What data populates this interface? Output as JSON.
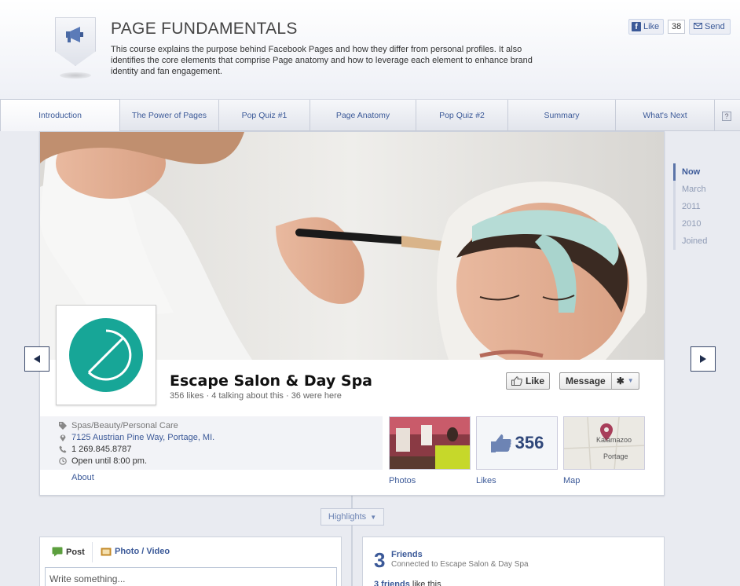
{
  "header": {
    "title": "PAGE FUNDAMENTALS",
    "description": "This course explains the purpose behind Facebook Pages and how they differ from personal profiles. It also identifies the core elements that comprise Page anatomy and how to leverage each element to enhance brand identity and fan engagement.",
    "like_label": "Like",
    "like_count": "38",
    "send_label": "Send",
    "help_label": "?"
  },
  "tabs": [
    {
      "label": "Introduction"
    },
    {
      "label": "The Power of Pages"
    },
    {
      "label": "Pop Quiz #1"
    },
    {
      "label": "Page Anatomy"
    },
    {
      "label": "Pop Quiz #2"
    },
    {
      "label": "Summary"
    },
    {
      "label": "What's Next"
    }
  ],
  "page": {
    "name": "Escape Salon & Day Spa",
    "stats": "356 likes · 4 talking about this · 36 were here",
    "like_button": "Like",
    "message_button": "Message",
    "info": {
      "category": "Spas/Beauty/Personal Care",
      "address": "7125 Austrian Pine Way, Portage, MI.",
      "phone": "1 269.845.8787",
      "hours": "Open until 8:00 pm."
    },
    "about_label": "About",
    "thumbs": {
      "photos_label": "Photos",
      "likes_label": "Likes",
      "likes_count": "356",
      "map_label": "Map",
      "map_city1": "Kalamazoo",
      "map_city2": "Portage"
    }
  },
  "timeline": [
    {
      "label": "Now"
    },
    {
      "label": "March"
    },
    {
      "label": "2011"
    },
    {
      "label": "2010"
    },
    {
      "label": "Joined"
    }
  ],
  "highlights_label": "Highlights",
  "composer": {
    "post_label": "Post",
    "photo_label": "Photo / Video",
    "placeholder": "Write something..."
  },
  "friends": {
    "count": "3",
    "title": "Friends",
    "subtitle_prefix": "Connected to",
    "subtitle_page": "Escape Salon & Day Spa",
    "like_line_link": "3 friends",
    "like_line_rest": "like this"
  },
  "colors": {
    "facebook_blue": "#3b5998",
    "logo_teal": "#17a697"
  }
}
